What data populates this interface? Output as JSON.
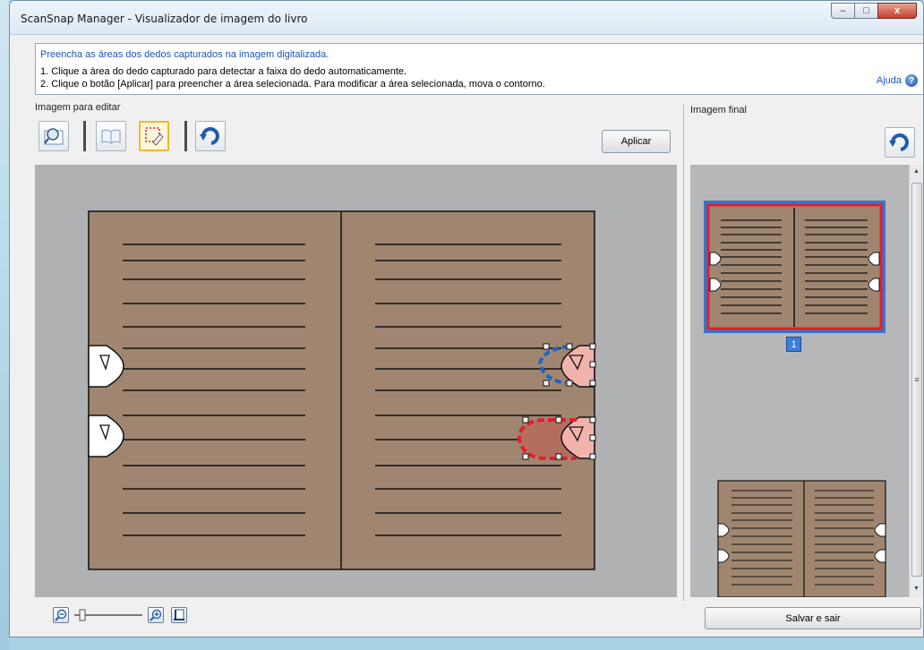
{
  "window": {
    "title": "ScanSnap Manager - Visualizador de imagem do livro",
    "minimize": "‒",
    "maximize": "□",
    "close": "x"
  },
  "info": {
    "heading": "Preencha as áreas dos dedos capturados na imagem digitalizada.",
    "step1": "1. Clique a área do dedo capturado para detectar a faixa do dedo automaticamente.",
    "step2": "2. Clique o botão [Aplicar] para preencher a área selecionada. Para modificar a área selecionada, mova o contorno.",
    "help_label": "Ajuda",
    "help_glyph": "?"
  },
  "left_panel": {
    "label": "Imagem para editar",
    "apply_button": "Aplicar"
  },
  "right_panel": {
    "label": "Imagem final",
    "page_number": "1"
  },
  "toolbar": {
    "icons": [
      "magnifier-icon",
      "book-icon",
      "finger-fill-icon",
      "undo-icon"
    ],
    "active": "finger-fill-icon"
  },
  "zoom": {
    "level": 0
  },
  "footer": {
    "save_button": "Salvar e sair"
  },
  "scrollbar": {
    "up": "▲",
    "down": "▼",
    "grip": "≡"
  },
  "colors": {
    "page": "#a08670",
    "selection_blue": "#1a64c8",
    "selection_red": "#e0202a",
    "finger_fill": "#f2b3ad",
    "filled_area": "#b46e5e",
    "thumb_selected": "#e0202a"
  }
}
